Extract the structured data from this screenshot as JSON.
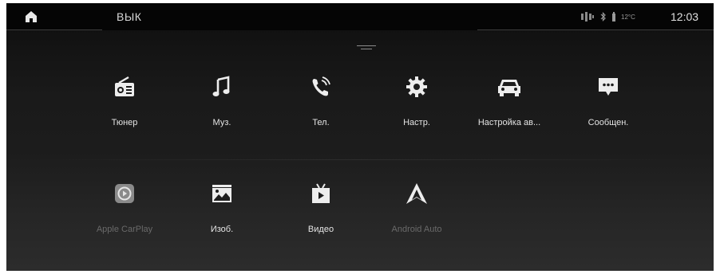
{
  "status_bar": {
    "home_icon": "home-icon",
    "source_label": "ВЫК",
    "temperature": "12°C",
    "clock": "12:03",
    "icons": [
      "signal-icon",
      "bluetooth-icon",
      "battery-icon"
    ]
  },
  "drawer_handle_icon": "drawer-handle-icon",
  "apps": [
    {
      "label": "Тюнер",
      "icon": "radio-icon",
      "enabled": true
    },
    {
      "label": "Муз.",
      "icon": "music-icon",
      "enabled": true
    },
    {
      "label": "Тел.",
      "icon": "phone-icon",
      "enabled": true
    },
    {
      "label": "Настр.",
      "icon": "settings-gear-icon",
      "enabled": true
    },
    {
      "label": "Настройка ав...",
      "icon": "car-icon",
      "enabled": true
    },
    {
      "label": "Сообщен.",
      "icon": "message-icon",
      "enabled": true
    },
    {
      "label": "Apple CarPlay",
      "icon": "carplay-icon",
      "enabled": false
    },
    {
      "label": "Изоб.",
      "icon": "image-icon",
      "enabled": true
    },
    {
      "label": "Видео",
      "icon": "video-icon",
      "enabled": true
    },
    {
      "label": "Android Auto",
      "icon": "android-auto-icon",
      "enabled": false
    }
  ],
  "colors": {
    "background": "#1c1c1c",
    "status_bar": "#050505",
    "label_active": "#e4e4e4",
    "label_disabled": "#6a6a6a"
  }
}
